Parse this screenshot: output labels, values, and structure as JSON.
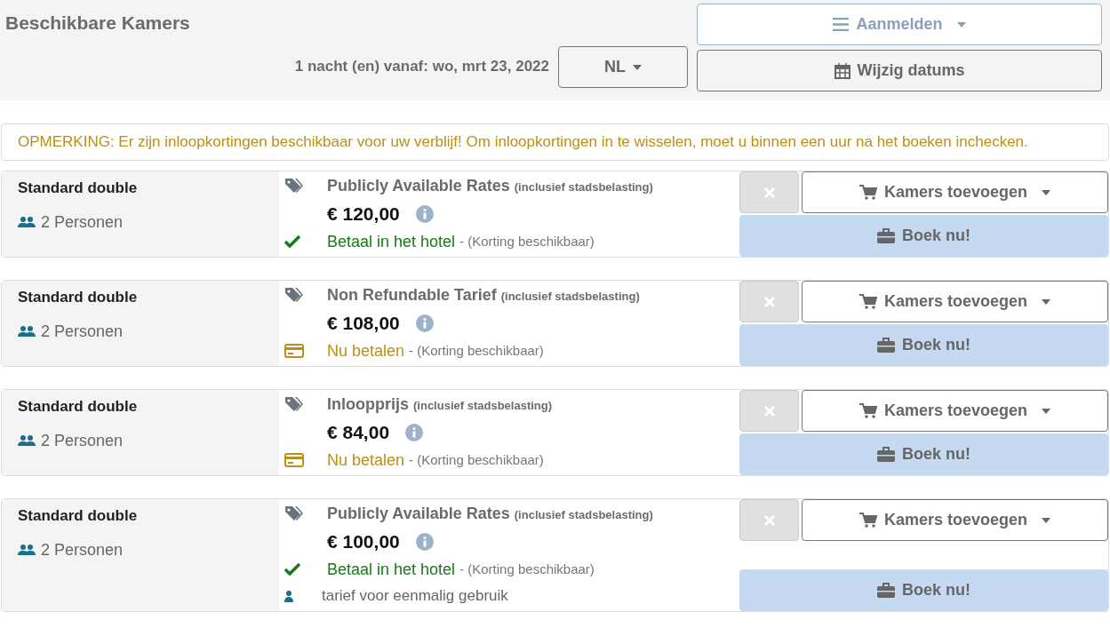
{
  "header": {
    "title": "Beschikbare Kamers",
    "login_button": "Aanmelden",
    "stay_info": "1 nacht (en) vanaf: wo, mrt 23, 2022",
    "language_button": "NL",
    "change_dates_button": "Wijzig datums"
  },
  "notice": "OPMERKING: Er zijn inloopkortingen beschikbaar voor uw verblijf! Om inloopkortingen in te wisselen, moet u binnen een uur na het boeken inchecken.",
  "rooms": [
    {
      "room_type": "Standard double",
      "guests": "2 Personen",
      "rate_name": "Publicly Available Rates",
      "rate_note": "(inclusief stadsbelasting)",
      "price": "€ 120,00",
      "payment": {
        "kind": "hotel",
        "label": "Betaal in het hotel",
        "note": "- (Korting beschikbaar)"
      },
      "add_button": "Kamers toevoegen",
      "book_button": "Boek nu!"
    },
    {
      "room_type": "Standard double",
      "guests": "2 Personen",
      "rate_name": "Non Refundable Tarief",
      "rate_note": "(inclusief stadsbelasting)",
      "price": "€ 108,00",
      "payment": {
        "kind": "now",
        "label": "Nu betalen",
        "note": "- (Korting beschikbaar)"
      },
      "add_button": "Kamers toevoegen",
      "book_button": "Boek nu!"
    },
    {
      "room_type": "Standard double",
      "guests": "2 Personen",
      "rate_name": "Inloopprijs",
      "rate_note": "(inclusief stadsbelasting)",
      "price": "€ 84,00",
      "payment": {
        "kind": "now",
        "label": "Nu betalen",
        "note": "- (Korting beschikbaar)"
      },
      "add_button": "Kamers toevoegen",
      "book_button": "Boek nu!"
    },
    {
      "room_type": "Standard double",
      "guests": "2 Personen",
      "rate_name": "Publicly Available Rates",
      "rate_note": "(inclusief stadsbelasting)",
      "price": "€ 100,00",
      "payment": {
        "kind": "hotel",
        "label": "Betaal in het hotel",
        "note": "- (Korting beschikbaar)"
      },
      "extra_note": "tarief voor eenmalig gebruik",
      "add_button": "Kamers toevoegen",
      "book_button": "Boek nu!"
    }
  ]
}
